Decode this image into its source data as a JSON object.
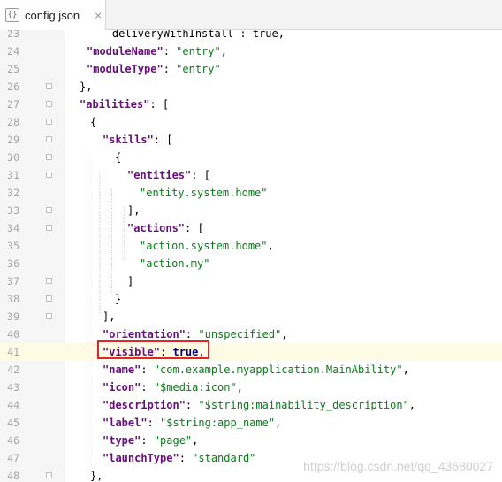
{
  "tab": {
    "icon": "{}",
    "title": "config.json",
    "close": "×"
  },
  "lines": [
    {
      "num": "23",
      "parts": [
        [
          "p",
          "    deliveryWithInstall : true,"
        ]
      ]
    },
    {
      "num": "24",
      "parts": [
        [
          "k",
          "\"moduleName\""
        ],
        [
          "p",
          ": "
        ],
        [
          "s",
          "\"entry\""
        ],
        [
          "p",
          ","
        ]
      ]
    },
    {
      "num": "25",
      "parts": [
        [
          "k",
          "\"moduleType\""
        ],
        [
          "p",
          ": "
        ],
        [
          "s",
          "\"entry\""
        ]
      ]
    },
    {
      "num": "26",
      "parts": [
        [
          "p",
          "},"
        ]
      ]
    },
    {
      "num": "27",
      "parts": [
        [
          "k",
          "\"abilities\""
        ],
        [
          "p",
          ": ["
        ]
      ]
    },
    {
      "num": "28",
      "parts": [
        [
          "p",
          "{"
        ]
      ]
    },
    {
      "num": "29",
      "parts": [
        [
          "k",
          "\"skills\""
        ],
        [
          "p",
          ": ["
        ]
      ]
    },
    {
      "num": "30",
      "parts": [
        [
          "p",
          "{"
        ]
      ]
    },
    {
      "num": "31",
      "parts": [
        [
          "k",
          "\"entities\""
        ],
        [
          "p",
          ": ["
        ]
      ]
    },
    {
      "num": "32",
      "parts": [
        [
          "s",
          "\"entity.system.home\""
        ]
      ]
    },
    {
      "num": "33",
      "parts": [
        [
          "p",
          "],"
        ]
      ]
    },
    {
      "num": "34",
      "parts": [
        [
          "k",
          "\"actions\""
        ],
        [
          "p",
          ": ["
        ]
      ]
    },
    {
      "num": "35",
      "parts": [
        [
          "s",
          "\"action.system.home\""
        ],
        [
          "p",
          ","
        ]
      ]
    },
    {
      "num": "36",
      "parts": [
        [
          "s",
          "\"action.my\""
        ]
      ]
    },
    {
      "num": "37",
      "parts": [
        [
          "p",
          "]"
        ]
      ]
    },
    {
      "num": "38",
      "parts": [
        [
          "p",
          "}"
        ]
      ]
    },
    {
      "num": "39",
      "parts": [
        [
          "p",
          "],"
        ]
      ]
    },
    {
      "num": "40",
      "parts": [
        [
          "k",
          "\"orientation\""
        ],
        [
          "p",
          ": "
        ],
        [
          "s",
          "\"unspecified\""
        ],
        [
          "p",
          ","
        ]
      ]
    },
    {
      "num": "41",
      "parts": [
        [
          "k",
          "\"visible\""
        ],
        [
          "p",
          ": "
        ],
        [
          "w",
          "true"
        ],
        [
          "p",
          ","
        ]
      ]
    },
    {
      "num": "42",
      "parts": [
        [
          "k",
          "\"name\""
        ],
        [
          "p",
          ": "
        ],
        [
          "s",
          "\"com.example.myapplication.MainAbility\""
        ],
        [
          "p",
          ","
        ]
      ]
    },
    {
      "num": "43",
      "parts": [
        [
          "k",
          "\"icon\""
        ],
        [
          "p",
          ": "
        ],
        [
          "s",
          "\"$media:icon\""
        ],
        [
          "p",
          ","
        ]
      ]
    },
    {
      "num": "44",
      "parts": [
        [
          "k",
          "\"description\""
        ],
        [
          "p",
          ": "
        ],
        [
          "s",
          "\"$string:mainability_description\""
        ],
        [
          "p",
          ","
        ]
      ]
    },
    {
      "num": "45",
      "parts": [
        [
          "k",
          "\"label\""
        ],
        [
          "p",
          ": "
        ],
        [
          "s",
          "\"$string:app_name\""
        ],
        [
          "p",
          ","
        ]
      ]
    },
    {
      "num": "46",
      "parts": [
        [
          "k",
          "\"type\""
        ],
        [
          "p",
          ": "
        ],
        [
          "s",
          "\"page\""
        ],
        [
          "p",
          ","
        ]
      ]
    },
    {
      "num": "47",
      "parts": [
        [
          "k",
          "\"launchType\""
        ],
        [
          "p",
          ": "
        ],
        [
          "s",
          "\"standard\""
        ]
      ]
    },
    {
      "num": "48",
      "parts": [
        [
          "p",
          "},"
        ]
      ]
    }
  ],
  "active_line": "41",
  "watermark": "https://blog.csdn.net/qq_43680027"
}
